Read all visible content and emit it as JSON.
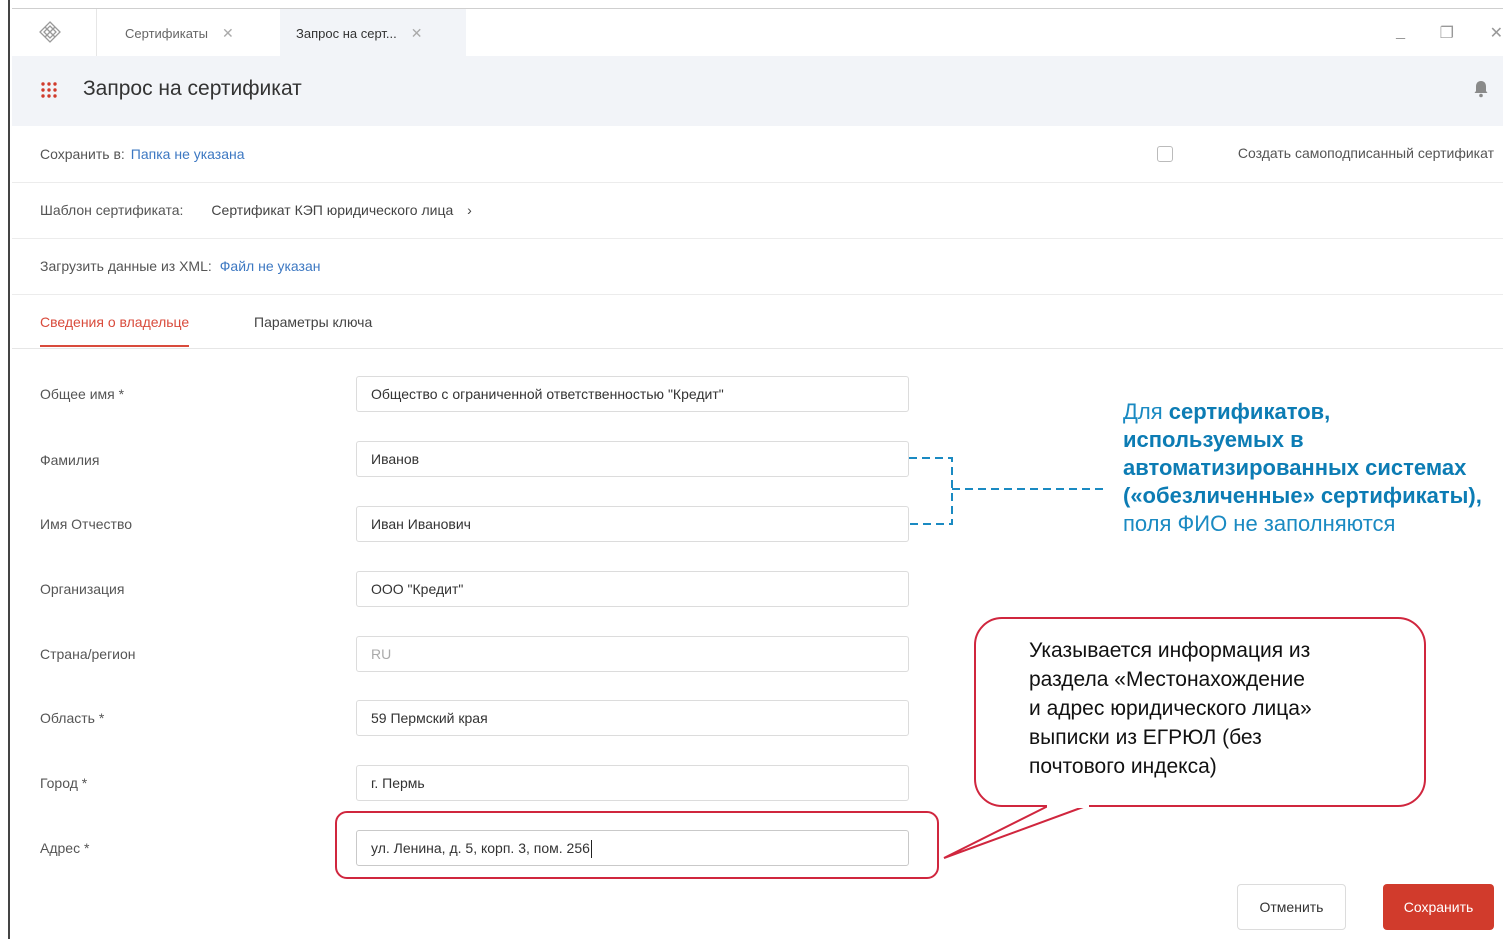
{
  "tabs": [
    {
      "label": "Сертификаты"
    },
    {
      "label": "Запрос на серт..."
    }
  ],
  "header": {
    "title": "Запрос на сертификат"
  },
  "save_to": {
    "label": "Сохранить в:",
    "value": "Папка не указана"
  },
  "self_signed": {
    "label": "Создать самоподписанный сертификат",
    "checked": false
  },
  "template": {
    "label": "Шаблон сертификата:",
    "value": "Сертификат КЭП юридического лица"
  },
  "xml": {
    "label": "Загрузить данные из XML:",
    "value": "Файл не указан"
  },
  "subtabs": [
    {
      "label": "Сведения о владельце",
      "active": true
    },
    {
      "label": "Параметры ключа",
      "active": false
    }
  ],
  "fields": [
    {
      "label": "Общее имя *",
      "value": "Общество с ограниченной ответственностью \"Кредит\""
    },
    {
      "label": "Фамилия",
      "value": "Иванов"
    },
    {
      "label": "Имя Отчество",
      "value": "Иван Иванович"
    },
    {
      "label": "Организация",
      "value": "ООО \"Кредит\""
    },
    {
      "label": "Страна/регион",
      "value": "RU"
    },
    {
      "label": "Область *",
      "value": "59 Пермский края"
    },
    {
      "label": "Город *",
      "value": "г. Пермь"
    },
    {
      "label": "Адрес *",
      "value": "ул. Ленина, д. 5, корп. 3, пом. 256"
    }
  ],
  "note_blue": {
    "part1": "Для ",
    "bold": "сертификатов, используемых в автоматизированных системах («обезличенные» сертификаты),",
    "part2": " поля ФИО не заполняются"
  },
  "callout": {
    "text": "Указывается информация из\nраздела  «Местонахождение\n и адрес юридического лица»\nвыписки из ЕГРЮЛ (без\nпочтового индекса)"
  },
  "buttons": {
    "cancel": "Отменить",
    "save": "Сохранить"
  },
  "colors": {
    "accent": "#d13b2c",
    "link": "#3d78c2",
    "note": "#1a8ac2",
    "callout_border": "#d0263e"
  }
}
